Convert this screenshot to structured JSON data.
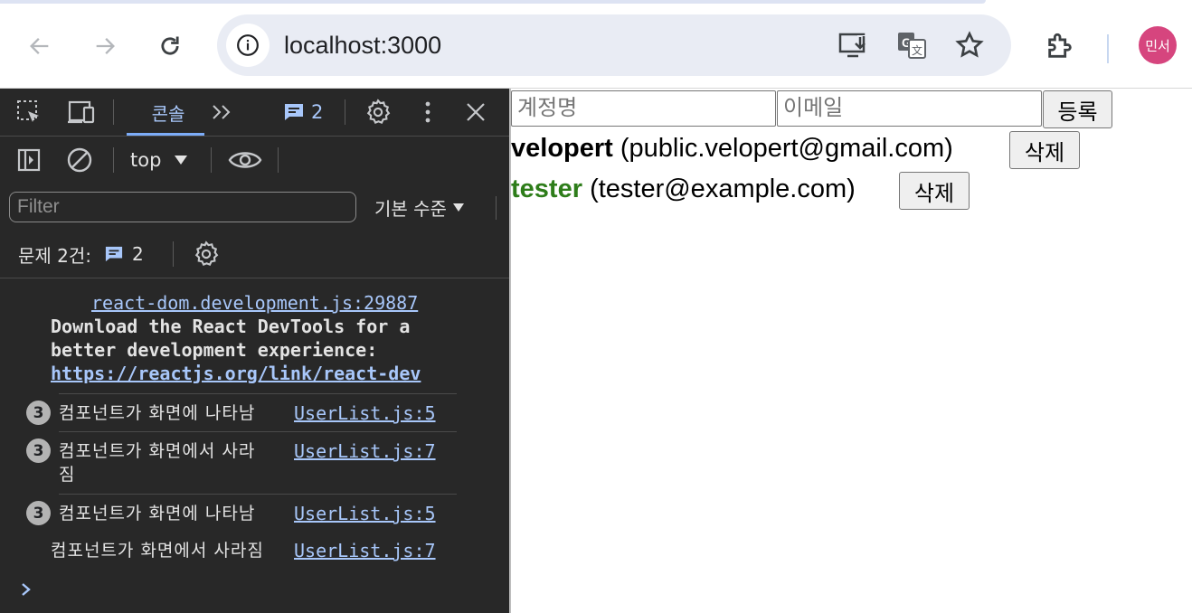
{
  "browser": {
    "url": "localhost:3000",
    "avatar_initials": "민서"
  },
  "devtools": {
    "tab_console": "콘솔",
    "message_count": "2",
    "context": "top",
    "filter_placeholder": "Filter",
    "levels_label": "기본 수준",
    "issues_label": "문제 2건:",
    "issues_count": "2",
    "console": {
      "devtools_notice": {
        "source": "react-dom.development.js:29887",
        "text_line1": "Download the React DevTools for a",
        "text_line2": "better development experience:",
        "link": "https://reactjs.org/link/react-dev"
      },
      "messages": [
        {
          "count": "3",
          "text": "컴포넌트가 화면에 나타남",
          "source": "UserList.js:5"
        },
        {
          "count": "3",
          "text_line1": "컴포넌트가 화면에서 사라",
          "text_line2": "짐",
          "source": "UserList.js:7"
        },
        {
          "count": "3",
          "text": "컴포넌트가 화면에 나타남",
          "source": "UserList.js:5"
        },
        {
          "text": "컴포넌트가 화면에서 사라짐",
          "source": "UserList.js:7"
        }
      ]
    }
  },
  "page": {
    "username_placeholder": "계정명",
    "email_placeholder": "이메일",
    "register_button": "등록",
    "users": [
      {
        "username": "velopert",
        "email": "(public.velopert@gmail.com)",
        "color": "#000000",
        "delete_label": "삭제"
      },
      {
        "username": "tester",
        "email": "(tester@example.com)",
        "color": "#2e7d1a",
        "delete_label": "삭제"
      }
    ]
  }
}
